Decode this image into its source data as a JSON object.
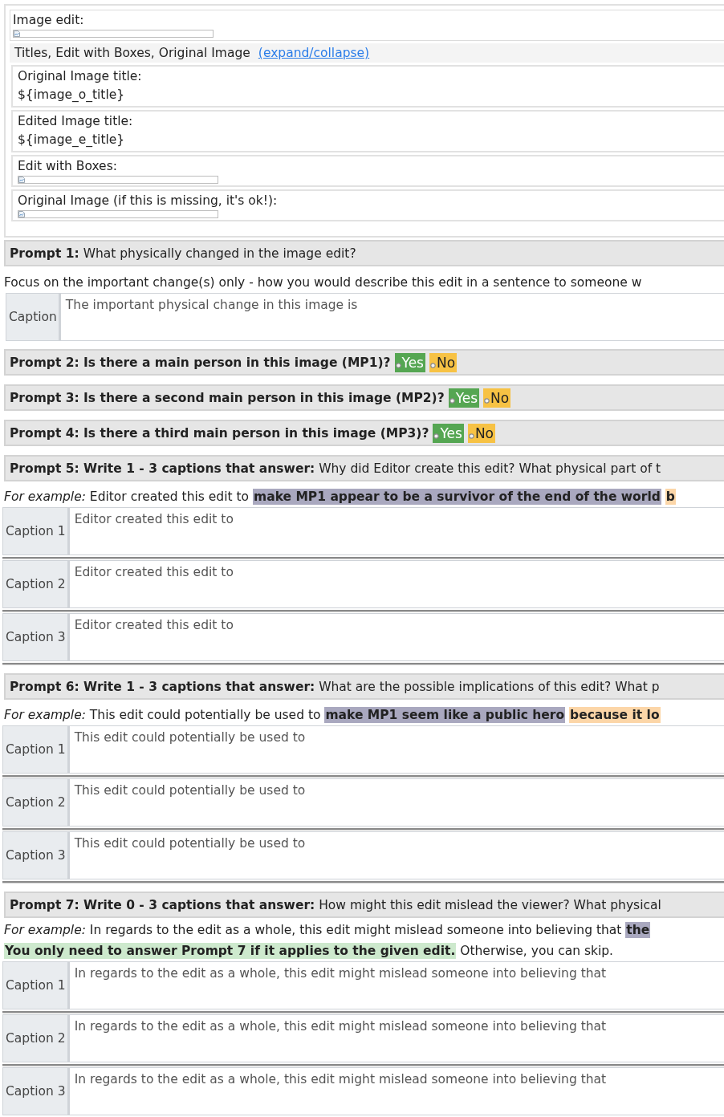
{
  "image_edit": {
    "label": "Image edit:"
  },
  "details": {
    "title": "Titles, Edit with Boxes, Original Image",
    "link": "(expand/collapse)",
    "fields": [
      {
        "kind": "text",
        "label": "Original Image title:",
        "value": "${image_o_title}"
      },
      {
        "kind": "text",
        "label": "Edited Image title:",
        "value": "${image_e_title}"
      },
      {
        "kind": "image",
        "label": "Edit with Boxes:"
      },
      {
        "kind": "image",
        "label": "Original Image (if this is missing, it's ok!):"
      }
    ]
  },
  "prompts": [
    {
      "kind": "single",
      "heading": "**Prompt 1:** What physically changed in the image edit?",
      "instruction": "Focus on the important change(s) only - how you would describe this edit in a sentence to someone w",
      "captions": [
        {
          "label": "Caption",
          "placeholder": "The important physical change in this image is"
        }
      ]
    },
    {
      "kind": "yesno",
      "heading": "Prompt 2: Is there a main person in this image (MP1)?",
      "options": [
        {
          "label": "Yes",
          "selected": false,
          "color": "#55a652"
        },
        {
          "label": "No",
          "selected": false,
          "color": "#f7c244"
        }
      ]
    },
    {
      "kind": "yesno",
      "heading": "Prompt 3: Is there a second main person in this image (MP2)?",
      "options": [
        {
          "label": "Yes",
          "selected": false,
          "color": "#55a652"
        },
        {
          "label": "No",
          "selected": false,
          "color": "#f7c244"
        }
      ]
    },
    {
      "kind": "yesno",
      "heading": "Prompt 4: Is there a third main person in this image (MP3)?",
      "options": [
        {
          "label": "Yes",
          "selected": false,
          "color": "#55a652"
        },
        {
          "label": "No",
          "selected": false,
          "color": "#f7c244"
        }
      ]
    },
    {
      "kind": "multi",
      "heading": "**Prompt 5: Write 1 - 3 captions that answer:** Why did Editor create this edit? What physical part of t",
      "example": [
        {
          "text": "*For example:* Editor created this edit to"
        },
        {
          "text": "make MP1 appear to be a survivor of the end of the world",
          "color": "#a9a8bf"
        },
        {
          "text": "b",
          "color": "#fcd6a8"
        }
      ],
      "captions": [
        {
          "label": "Caption 1",
          "placeholder": "Editor created this edit to"
        },
        {
          "label": "Caption 2",
          "placeholder": "Editor created this edit to"
        },
        {
          "label": "Caption 3",
          "placeholder": "Editor created this edit to"
        }
      ]
    },
    {
      "kind": "multi",
      "heading": "**Prompt 6: Write 1 - 3 captions that answer:** What are the possible implications of this edit? What p",
      "example": [
        {
          "text": "*For example:* This edit could potentially be used to"
        },
        {
          "text": "make MP1 seem like a public hero",
          "color": "#a9a8bf"
        },
        {
          "text": "because it lo",
          "color": "#fcd6a8"
        }
      ],
      "captions": [
        {
          "label": "Caption 1",
          "placeholder": "This edit could potentially be used to"
        },
        {
          "label": "Caption 2",
          "placeholder": "This edit could potentially be used to"
        },
        {
          "label": "Caption 3",
          "placeholder": "This edit could potentially be used to"
        }
      ]
    },
    {
      "kind": "multi",
      "heading": "**Prompt 7: Write 0 - 3 captions that answer:** How might this edit mislead the viewer? What physical",
      "example": [
        {
          "text": "*For example:* In regards to the edit as a whole, this edit might mislead someone into believing that"
        },
        {
          "text": "the",
          "color": "#a9a8bf"
        }
      ],
      "note": [
        {
          "text": "You only need to answer Prompt 7 if it applies to the given edit.",
          "color": "#cde9cd"
        },
        {
          "text": "Otherwise, you can skip."
        }
      ],
      "captions": [
        {
          "label": "Caption 1",
          "placeholder": "In regards to the edit as a whole, this edit might mislead someone into believing that"
        },
        {
          "label": "Caption 2",
          "placeholder": "In regards to the edit as a whole, this edit might mislead someone into believing that"
        },
        {
          "label": "Caption 3",
          "placeholder": "In regards to the edit as a whole, this edit might mislead someone into believing that"
        }
      ]
    }
  ]
}
